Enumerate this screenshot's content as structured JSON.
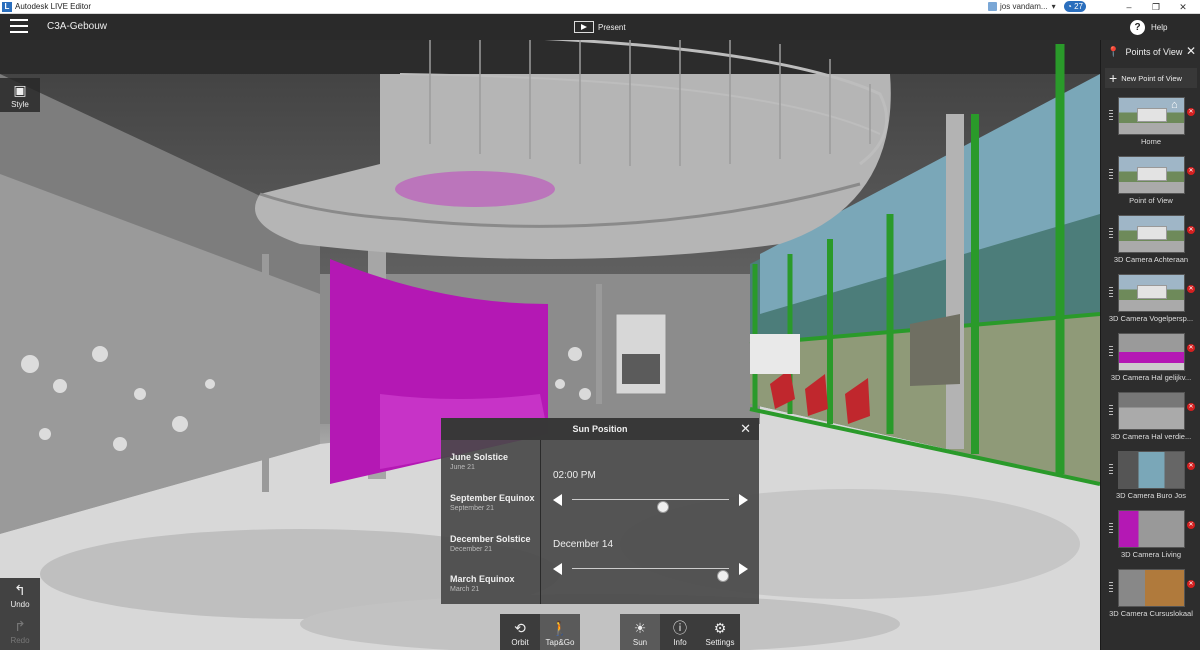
{
  "titlebar": {
    "app_title": "Autodesk LIVE Editor",
    "user": "jos vandam...",
    "notification_count": "27",
    "min": "–",
    "max": "❐",
    "close": "✕"
  },
  "topbar": {
    "doc_title": "C3A-Gebouw",
    "present_label": "Present",
    "help_label": "Help"
  },
  "tools": {
    "style_label": "Style",
    "undo_label": "Undo",
    "redo_label": "Redo"
  },
  "points_of_view": {
    "title": "Points of View",
    "new_label": "New Point of View",
    "items": [
      {
        "label": "Home"
      },
      {
        "label": "Point of View"
      },
      {
        "label": "3D Camera Achteraan"
      },
      {
        "label": "3D Camera Vogelpersp..."
      },
      {
        "label": "3D Camera Hal gelijkv..."
      },
      {
        "label": "3D Camera Hal verdie..."
      },
      {
        "label": "3D Camera Buro Jos"
      },
      {
        "label": "3D Camera Living"
      },
      {
        "label": "3D Camera Cursuslokaal"
      }
    ]
  },
  "sun_position": {
    "title": "Sun Position",
    "presets": [
      {
        "title": "June Solstice",
        "date": "June 21"
      },
      {
        "title": "September Equinox",
        "date": "September 21"
      },
      {
        "title": "December Solstice",
        "date": "December 21"
      },
      {
        "title": "March Equinox",
        "date": "March 21"
      }
    ],
    "time": "02:00 PM",
    "time_level": 0.58,
    "date": "December 14",
    "date_level": 0.96
  },
  "bottom_toolbar": {
    "orbit": "Orbit",
    "tapgo": "Tap&Go",
    "sun": "Sun",
    "info": "Info",
    "settings": "Settings"
  },
  "icons": {
    "menu": "hamburger-icon",
    "present": "present-icon",
    "help": "help-icon",
    "style": "style-icon",
    "undo": "undo-icon",
    "redo": "redo-icon",
    "pin": "map-pin-icon",
    "plus": "plus-icon",
    "close": "close-icon",
    "home": "home-icon",
    "delete": "delete-icon",
    "orbit": "orbit-icon",
    "tapgo": "walk-icon",
    "sun": "sun-icon",
    "info": "info-icon",
    "settings": "gears-icon"
  }
}
